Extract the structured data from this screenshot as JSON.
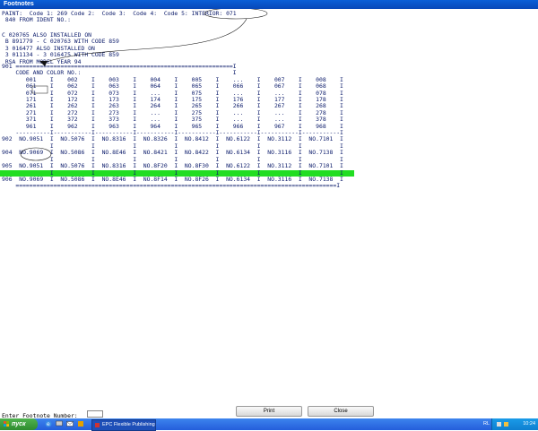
{
  "window": {
    "title": "Footnotes"
  },
  "header_text": "PAINT:  Code 1: 269 Code 2:  Code 3:  Code 4:  Code 5: INTERIOR: 071\n 840 FROM IDENT NO.:",
  "notes_text": "C 020765 ALSO INSTALLED ON\n B 891779 - C 020763 WITH CODE 859\n 3 016477 ALSO INSTALLED ON\n 3 011134 - 3 016475 WITH CODE 859\n RSA FROM MODEL YEAR 94",
  "footnote_table_text": "901 ===============================================================I\n    CODE AND COLOR NO.:                                            I\n       001    I    002    I    003    I    004    I    005    I    ...    I    007    I    008    I\n       061    I    062    I    063    I    064    I    065    I    066    I    067    I    068    I\n       071    I    072    I    073    I    ...    I    075    I    ...    I    ...    I    078    I\n       171    I    172    I    173    I    174    I    175    I    176    I    177    I    178    I\n       261    I    262    I    263    I    264    I    265    I    266    I    267    I    268    I\n       271    I    272    I    273    I    ...    I    275    I    ...    I    ...    I    278    I\n       371    I    372    I    373    I    ...    I    375    I    ...    I    ...    I    378    I\n       961    I    962    I    963    I    964    I    965    I    966    I    967    I    968    I\n    ----------I-----------I-----------I-----------I-----------I-----------I-----------I-----------I\n902  NO.9051  I  NO.5076  I  NO.8316  I  NO.8326  I  NO.8412  I  NO.6122  I  NO.3112  I  NO.7101  I\n              I           I           I           I           I           I           I           I\n904  NO.9069  I  NO.5086  I  NO.8E46  I  NO.8421  I  NO.8422  I  NO.6134  I  NO.3116  I  NO.7138  I\n              I           I           I           I           I           I           I           I\n905  NO.9051  I  NO.5076  I  NO.8316  I  NO.8F20  I  NO.8F30  I  NO.6122  I  NO.3112  I  NO.7101  I\n              I           I           I           I           I           I           I           I\n906  NO.9069  I  NO.5086  I  NO.8E46  I  NO.8F14  I  NO.8F26  I  NO.6134  I  NO.3116  I  NO.7138  I\n    =============================================================================================I",
  "highlight": {
    "color": "#22dd22",
    "row_label": "905"
  },
  "footer": {
    "prompt_label": "Enter Footnote Number:",
    "footnote_input_value": "",
    "print_label": "Print",
    "close_label": "Close"
  },
  "taskbar": {
    "start_label": "пуск",
    "task_label": "EPC Flexible Publishing",
    "lang": "RL",
    "clock": "10:24"
  },
  "colors": {
    "title_bar": "#0848b8",
    "text": "#0a1a6a",
    "taskbar": "#245edb",
    "start_button": "#2e8b2e"
  }
}
